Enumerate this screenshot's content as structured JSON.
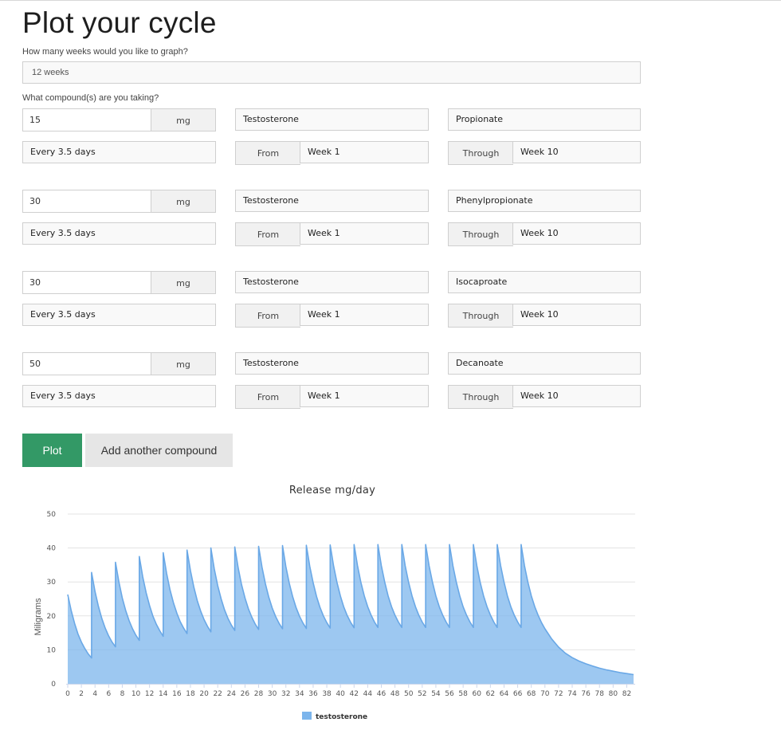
{
  "page": {
    "title": "Plot your cycle",
    "weeks_question": "How many weeks would you like to graph?",
    "weeks_value": "12 weeks",
    "compounds_question": "What compound(s) are you taking?"
  },
  "compounds": [
    {
      "dose": "15",
      "unit": "mg",
      "drug": "Testosterone",
      "ester": "Propionate",
      "frequency": "Every 3.5 days",
      "from_label": "From",
      "from": "Week 1",
      "through_label": "Through",
      "through": "Week 10"
    },
    {
      "dose": "30",
      "unit": "mg",
      "drug": "Testosterone",
      "ester": "Phenylpropionate",
      "frequency": "Every 3.5 days",
      "from_label": "From",
      "from": "Week 1",
      "through_label": "Through",
      "through": "Week 10"
    },
    {
      "dose": "30",
      "unit": "mg",
      "drug": "Testosterone",
      "ester": "Isocaproate",
      "frequency": "Every 3.5 days",
      "from_label": "From",
      "from": "Week 1",
      "through_label": "Through",
      "through": "Week 10"
    },
    {
      "dose": "50",
      "unit": "mg",
      "drug": "Testosterone",
      "ester": "Decanoate",
      "frequency": "Every 3.5 days",
      "from_label": "From",
      "from": "Week 1",
      "through_label": "Through",
      "through": "Week 10"
    }
  ],
  "buttons": {
    "plot": "Plot",
    "add": "Add another compound"
  },
  "colors": {
    "plot_button": "#339966",
    "series_fill": "#7cb5ec",
    "series_line": "#6aa8e6"
  },
  "chart_data": {
    "type": "area",
    "title": "Release mg/day",
    "xlabel": "",
    "ylabel": "Miligrams",
    "xlim": [
      0,
      83
    ],
    "ylim": [
      0,
      50
    ],
    "yticks": [
      0,
      10,
      20,
      30,
      40,
      50
    ],
    "xticks": [
      0,
      2,
      4,
      6,
      8,
      10,
      12,
      14,
      16,
      18,
      20,
      22,
      24,
      26,
      28,
      30,
      32,
      34,
      36,
      38,
      40,
      42,
      44,
      46,
      48,
      50,
      52,
      54,
      56,
      58,
      60,
      62,
      64,
      66,
      68,
      70,
      72,
      74,
      76,
      78,
      80,
      82
    ],
    "grid": true,
    "legend": "bottom-center",
    "series": [
      {
        "name": "testosterone",
        "points": [
          [
            0,
            26.3
          ],
          [
            0.5,
            21.6
          ],
          [
            1,
            17.8
          ],
          [
            1.5,
            14.7
          ],
          [
            2,
            12.3
          ],
          [
            2.5,
            10.4
          ],
          [
            3,
            8.8
          ],
          [
            3.5,
            7.6
          ],
          [
            3.5,
            32.8
          ],
          [
            4,
            27.2
          ],
          [
            4.5,
            22.8
          ],
          [
            5,
            19.2
          ],
          [
            5.5,
            16.4
          ],
          [
            6,
            14.1
          ],
          [
            6.5,
            12.3
          ],
          [
            7,
            10.9
          ],
          [
            7,
            35.8
          ],
          [
            7.5,
            30.0
          ],
          [
            8,
            25.3
          ],
          [
            8.5,
            21.6
          ],
          [
            9,
            18.6
          ],
          [
            9.5,
            16.2
          ],
          [
            10,
            14.3
          ],
          [
            10.5,
            12.8
          ],
          [
            10.5,
            37.5
          ],
          [
            11,
            31.5
          ],
          [
            11.5,
            26.8
          ],
          [
            12,
            23.0
          ],
          [
            12.5,
            19.9
          ],
          [
            13,
            17.5
          ],
          [
            13.5,
            15.6
          ],
          [
            14,
            14.0
          ],
          [
            14,
            38.6
          ],
          [
            14.5,
            32.6
          ],
          [
            15,
            27.7
          ],
          [
            15.5,
            23.9
          ],
          [
            16,
            20.8
          ],
          [
            16.5,
            18.3
          ],
          [
            17,
            16.4
          ],
          [
            17.5,
            14.8
          ],
          [
            17.5,
            39.4
          ],
          [
            18,
            33.3
          ],
          [
            18.5,
            28.4
          ],
          [
            19,
            24.5
          ],
          [
            19.5,
            21.4
          ],
          [
            20,
            18.9
          ],
          [
            20.5,
            16.9
          ],
          [
            21,
            15.3
          ],
          [
            21,
            40.0
          ],
          [
            21.5,
            33.8
          ],
          [
            22,
            28.9
          ],
          [
            22.5,
            25.0
          ],
          [
            23,
            21.8
          ],
          [
            23.5,
            19.3
          ],
          [
            24,
            17.3
          ],
          [
            24.5,
            15.7
          ],
          [
            24.5,
            40.3
          ],
          [
            25,
            34.1
          ],
          [
            25.5,
            29.2
          ],
          [
            26,
            25.3
          ],
          [
            26.5,
            22.1
          ],
          [
            27,
            19.6
          ],
          [
            27.5,
            17.6
          ],
          [
            28,
            16.0
          ],
          [
            28,
            40.5
          ],
          [
            28.5,
            34.3
          ],
          [
            29,
            29.4
          ],
          [
            29.5,
            25.5
          ],
          [
            30,
            22.3
          ],
          [
            30.5,
            19.8
          ],
          [
            31,
            17.8
          ],
          [
            31.5,
            16.2
          ],
          [
            31.5,
            40.7
          ],
          [
            32,
            34.5
          ],
          [
            32.5,
            29.6
          ],
          [
            33,
            25.6
          ],
          [
            33.5,
            22.4
          ],
          [
            34,
            19.9
          ],
          [
            34.5,
            17.9
          ],
          [
            35,
            16.3
          ],
          [
            35,
            40.8
          ],
          [
            35.5,
            34.6
          ],
          [
            36,
            29.7
          ],
          [
            36.5,
            25.7
          ],
          [
            37,
            22.5
          ],
          [
            37.5,
            20.0
          ],
          [
            38,
            18.0
          ],
          [
            38.5,
            16.4
          ],
          [
            38.5,
            40.9
          ],
          [
            39,
            34.7
          ],
          [
            39.5,
            29.8
          ],
          [
            40,
            25.8
          ],
          [
            40.5,
            22.6
          ],
          [
            41,
            20.1
          ],
          [
            41.5,
            18.1
          ],
          [
            42,
            16.5
          ],
          [
            42,
            41.0
          ],
          [
            42.5,
            34.8
          ],
          [
            43,
            29.9
          ],
          [
            43.5,
            25.9
          ],
          [
            44,
            22.7
          ],
          [
            44.5,
            20.2
          ],
          [
            45,
            18.2
          ],
          [
            45.5,
            16.6
          ],
          [
            45.5,
            41.0
          ],
          [
            46,
            34.8
          ],
          [
            46.5,
            29.9
          ],
          [
            47,
            25.9
          ],
          [
            47.5,
            22.7
          ],
          [
            48,
            20.2
          ],
          [
            48.5,
            18.2
          ],
          [
            49,
            16.6
          ],
          [
            49,
            41.0
          ],
          [
            49.5,
            34.8
          ],
          [
            50,
            29.9
          ],
          [
            50.5,
            25.9
          ],
          [
            51,
            22.7
          ],
          [
            51.5,
            20.2
          ],
          [
            52,
            18.2
          ],
          [
            52.5,
            16.6
          ],
          [
            52.5,
            41.0
          ],
          [
            53,
            34.8
          ],
          [
            53.5,
            29.9
          ],
          [
            54,
            25.9
          ],
          [
            54.5,
            22.7
          ],
          [
            55,
            20.2
          ],
          [
            55.5,
            18.2
          ],
          [
            56,
            16.6
          ],
          [
            56,
            41.0
          ],
          [
            56.5,
            34.8
          ],
          [
            57,
            29.9
          ],
          [
            57.5,
            25.9
          ],
          [
            58,
            22.7
          ],
          [
            58.5,
            20.2
          ],
          [
            59,
            18.2
          ],
          [
            59.5,
            16.6
          ],
          [
            59.5,
            41.0
          ],
          [
            60,
            34.8
          ],
          [
            60.5,
            29.9
          ],
          [
            61,
            25.9
          ],
          [
            61.5,
            22.7
          ],
          [
            62,
            20.2
          ],
          [
            62.5,
            18.2
          ],
          [
            63,
            16.6
          ],
          [
            63,
            41.0
          ],
          [
            63.5,
            34.8
          ],
          [
            64,
            29.9
          ],
          [
            64.5,
            25.9
          ],
          [
            65,
            22.7
          ],
          [
            65.5,
            20.2
          ],
          [
            66,
            18.2
          ],
          [
            66.5,
            16.6
          ],
          [
            66.5,
            41.0
          ],
          [
            67,
            34.8
          ],
          [
            67.5,
            29.9
          ],
          [
            68,
            25.9
          ],
          [
            68.5,
            22.7
          ],
          [
            69,
            20.2
          ],
          [
            69.5,
            18.0
          ],
          [
            70,
            16.2
          ],
          [
            71,
            13.2
          ],
          [
            72,
            10.8
          ],
          [
            73,
            9.0
          ],
          [
            74,
            7.7
          ],
          [
            75,
            6.7
          ],
          [
            76,
            5.9
          ],
          [
            77,
            5.2
          ],
          [
            78,
            4.6
          ],
          [
            79,
            4.1
          ],
          [
            80,
            3.7
          ],
          [
            81,
            3.3
          ],
          [
            82,
            3.0
          ],
          [
            83,
            2.7
          ]
        ]
      }
    ]
  }
}
